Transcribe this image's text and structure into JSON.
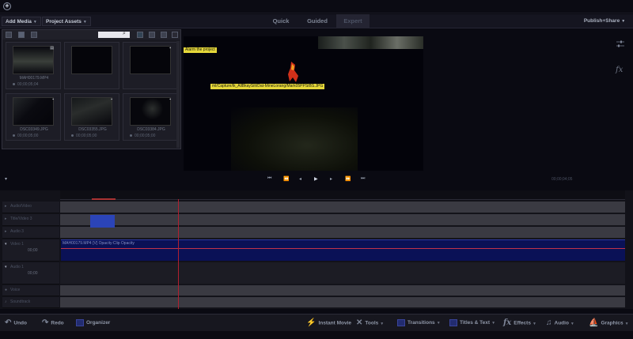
{
  "menubar": {
    "add_media": "Add Media",
    "project_assets": "Project Assets",
    "tabs": [
      "Quick",
      "Guided",
      "Expert"
    ],
    "share": "Publish+Share"
  },
  "assets": {
    "search_placeholder": "",
    "items": [
      {
        "name": "MAH00179.MP4",
        "duration": "00;00;05;04",
        "badge": "▤"
      },
      {
        "name": "",
        "duration": "",
        "badge": ""
      },
      {
        "name": "",
        "duration": "",
        "badge": "▪"
      },
      {
        "name": "DSC03349.JPG",
        "duration": "00;00;05;00",
        "badge": "▪"
      },
      {
        "name": "DSC03355.JPG",
        "duration": "00;00;05;00",
        "badge": "▪"
      },
      {
        "name": "DSC03384.JPG",
        "duration": "00;00;05;00",
        "badge": "▪"
      }
    ]
  },
  "monitor": {
    "overlay_1": "Alarm the project",
    "overlay_2": "ml/Capture/lk_AllBkaySilt/Dat-MineLorang/Mark05PPSIBS.JPG"
  },
  "right_panel": {
    "fx": "fx"
  },
  "transport": {
    "timecode": "00;00;04;05"
  },
  "timeline": {
    "tracks": [
      {
        "label": "Audio/Video",
        "sub": ""
      },
      {
        "label": "Title/Video 3",
        "sub": ""
      },
      {
        "label": "Audio 3",
        "sub": ""
      },
      {
        "label": "Video 1",
        "sub": "00;00"
      },
      {
        "label": "Audio 1",
        "sub": "00;00"
      },
      {
        "label": "Voice",
        "sub": ""
      },
      {
        "label": "Soundtrack",
        "sub": ""
      }
    ],
    "clip_title": "MAH00179.MP4 [V] Opacity:Clip Opacity"
  },
  "bottombar": {
    "undo": "Undo",
    "redo": "Redo",
    "organizer": "Organizer",
    "instant_movie": "Instant Movie",
    "tools": "Tools",
    "transitions": "Transitions",
    "titles": "Titles & Text",
    "effects": "Effects",
    "audio": "Audio",
    "graphics": "Graphics"
  }
}
